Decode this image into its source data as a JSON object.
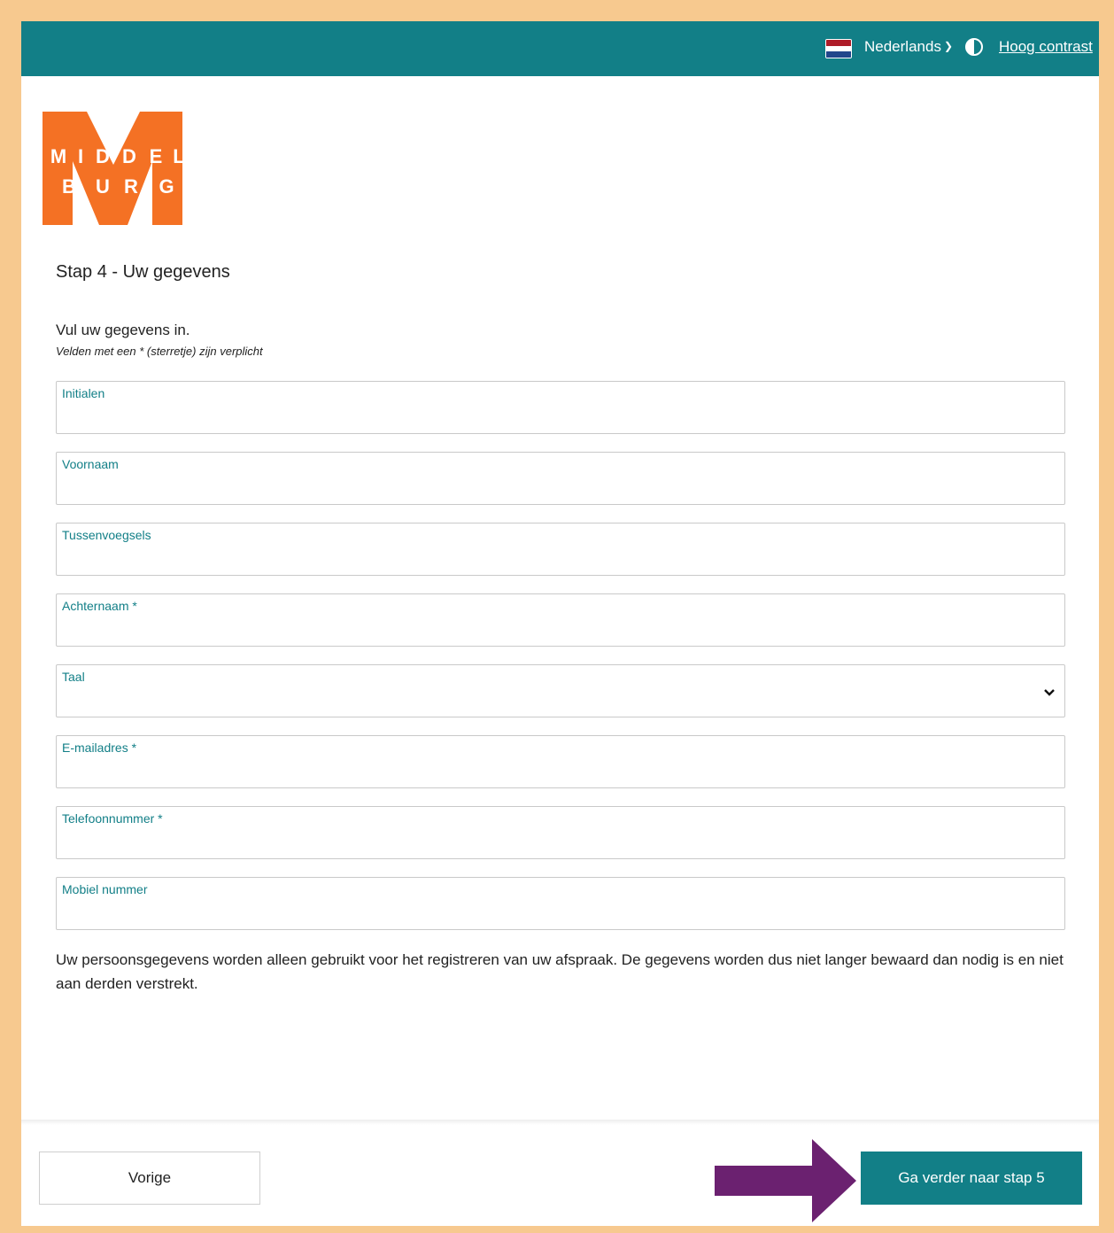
{
  "header": {
    "language": "Nederlands",
    "contrast_link": "Hoog contrast"
  },
  "logo": {
    "letters_row1": [
      "M",
      "I",
      "D",
      "D",
      "E",
      "L"
    ],
    "letters_row2": [
      "B",
      "U",
      "R",
      "G"
    ]
  },
  "step_title": "Stap 4 - Uw gegevens",
  "intro": "Vul uw gegevens in.",
  "required_note": "Velden met een * (sterretje) zijn verplicht",
  "fields": [
    {
      "label": "Initialen",
      "value": ""
    },
    {
      "label": "Voornaam",
      "value": ""
    },
    {
      "label": "Tussenvoegsels",
      "value": ""
    },
    {
      "label": "Achternaam *",
      "value": ""
    },
    {
      "label": "Taal",
      "value": ""
    },
    {
      "label": "E-mailadres *",
      "value": ""
    },
    {
      "label": "Telefoonnummer *",
      "value": ""
    },
    {
      "label": "Mobiel nummer",
      "value": ""
    }
  ],
  "privacy_text": "Uw persoonsgegevens worden alleen gebruikt voor het registreren van uw afspraak. De gegevens worden dus niet langer bewaard dan nodig is en niet aan derden verstrekt.",
  "buttons": {
    "previous": "Vorige",
    "next": "Ga verder naar stap 5"
  },
  "colors": {
    "brand_teal": "#127f87",
    "logo_orange": "#f47124",
    "annotation_arrow": "#6b2170",
    "page_border": "#f7c98f"
  },
  "icons": [
    "netherlands-flag-icon",
    "chevron-down-icon",
    "contrast-icon",
    "arrow-right-icon"
  ]
}
